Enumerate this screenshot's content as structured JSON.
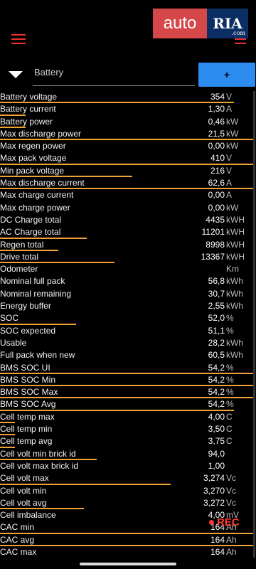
{
  "watermark": {
    "auto": "auto",
    "ria": "RIA",
    "ria_domain": ".com"
  },
  "filter": {
    "value": "Battery"
  },
  "add_button": {
    "label": "+"
  },
  "colors": {
    "accent_bar": "#f0a236",
    "button": "#2d8cf0",
    "rec": "#ff3b30"
  },
  "rows": [
    {
      "label": "Battery voltage",
      "value": "354",
      "unit": "V",
      "bar_fraction": 0.92
    },
    {
      "label": "Battery current",
      "value": "1,30",
      "unit": "A",
      "bar_fraction": 0.1
    },
    {
      "label": "Battery power",
      "value": "0,46",
      "unit": "kW",
      "bar_fraction": 0.1
    },
    {
      "label": "Max discharge power",
      "value": "21,5",
      "unit": "kW",
      "bar_fraction": 1.0
    },
    {
      "label": "Max regen power",
      "value": "0,00",
      "unit": "kW",
      "bar_fraction": 0.0
    },
    {
      "label": "Max pack voltage",
      "value": "410",
      "unit": "V",
      "bar_fraction": 1.0
    },
    {
      "label": "Min pack voltage",
      "value": "216",
      "unit": "V",
      "bar_fraction": 0.52
    },
    {
      "label": "Max discharge current",
      "value": "62,6",
      "unit": "A",
      "bar_fraction": 1.0
    },
    {
      "label": "Max charge current",
      "value": "0,00",
      "unit": "A",
      "bar_fraction": 0.0
    },
    {
      "label": "Max charge power",
      "value": "0,00",
      "unit": "kW",
      "bar_fraction": 0.0
    },
    {
      "label": "DC Charge total",
      "value": "4435",
      "unit": "kWH",
      "bar_fraction": 0.0
    },
    {
      "label": "AC Charge total",
      "value": "11201",
      "unit": "kWH",
      "bar_fraction": 0.34
    },
    {
      "label": "Regen total",
      "value": "8998",
      "unit": "kWH",
      "bar_fraction": 0.23
    },
    {
      "label": "Drive total",
      "value": "13367",
      "unit": "kWH",
      "bar_fraction": 0.45
    },
    {
      "label": "Odometer",
      "value": "",
      "unit": "Km",
      "bar_fraction": 0.0
    },
    {
      "label": "Nominal full pack",
      "value": "56,8",
      "unit": "kWh",
      "bar_fraction": 0.0
    },
    {
      "label": "Nominal remaining",
      "value": "30,7",
      "unit": "kWh",
      "bar_fraction": 0.0
    },
    {
      "label": "Energy buffer",
      "value": "2,55",
      "unit": "kWh",
      "bar_fraction": 0.0
    },
    {
      "label": "SOC",
      "value": "52,0",
      "unit": "%",
      "bar_fraction": 0.3
    },
    {
      "label": "SOC expected",
      "value": "51,1",
      "unit": "%",
      "bar_fraction": 0.0
    },
    {
      "label": "Usable",
      "value": "28,2",
      "unit": "kWh",
      "bar_fraction": 0.0
    },
    {
      "label": "Full pack when new",
      "value": "60,5",
      "unit": "kWh",
      "bar_fraction": 0.0
    },
    {
      "label": "BMS SOC UI",
      "value": "54,2",
      "unit": "%",
      "bar_fraction": 1.0
    },
    {
      "label": "BMS SOC Min",
      "value": "54,2",
      "unit": "%",
      "bar_fraction": 1.0
    },
    {
      "label": "BMS SOC Max",
      "value": "54,2",
      "unit": "%",
      "bar_fraction": 1.0
    },
    {
      "label": "BMS SOC Avg",
      "value": "54,2",
      "unit": "%",
      "bar_fraction": 0.92
    },
    {
      "label": "Cell temp max",
      "value": "4,00",
      "unit": "C",
      "bar_fraction": 0.06
    },
    {
      "label": "Cell temp min",
      "value": "3,50",
      "unit": "C",
      "bar_fraction": 0.06
    },
    {
      "label": "Cell temp avg",
      "value": "3,75",
      "unit": "C",
      "bar_fraction": 0.06
    },
    {
      "label": "Cell volt min brick id",
      "value": "94,0",
      "unit": "",
      "bar_fraction": 0.38
    },
    {
      "label": "Cell volt max brick id",
      "value": "1,00",
      "unit": "",
      "bar_fraction": 0.0
    },
    {
      "label": "Cell volt max",
      "value": "3,274",
      "unit": "Vc",
      "bar_fraction": 0.67
    },
    {
      "label": "Cell volt min",
      "value": "3,270",
      "unit": "Vc",
      "bar_fraction": 0.0
    },
    {
      "label": "Cell volt avg",
      "value": "3,272",
      "unit": "Vc",
      "bar_fraction": 0.33
    },
    {
      "label": "Cell imbalance",
      "value": "4,00",
      "unit": "mV",
      "bar_fraction": 0.0
    },
    {
      "label": "CAC min",
      "value": "164",
      "unit": "Ah",
      "bar_fraction": 1.0
    },
    {
      "label": "CAC avg",
      "value": "164",
      "unit": "Ah",
      "bar_fraction": 1.0
    },
    {
      "label": "CAC max",
      "value": "164",
      "unit": "Ah",
      "bar_fraction": 0.0
    }
  ],
  "overlay": {
    "rec_label": "REC"
  }
}
